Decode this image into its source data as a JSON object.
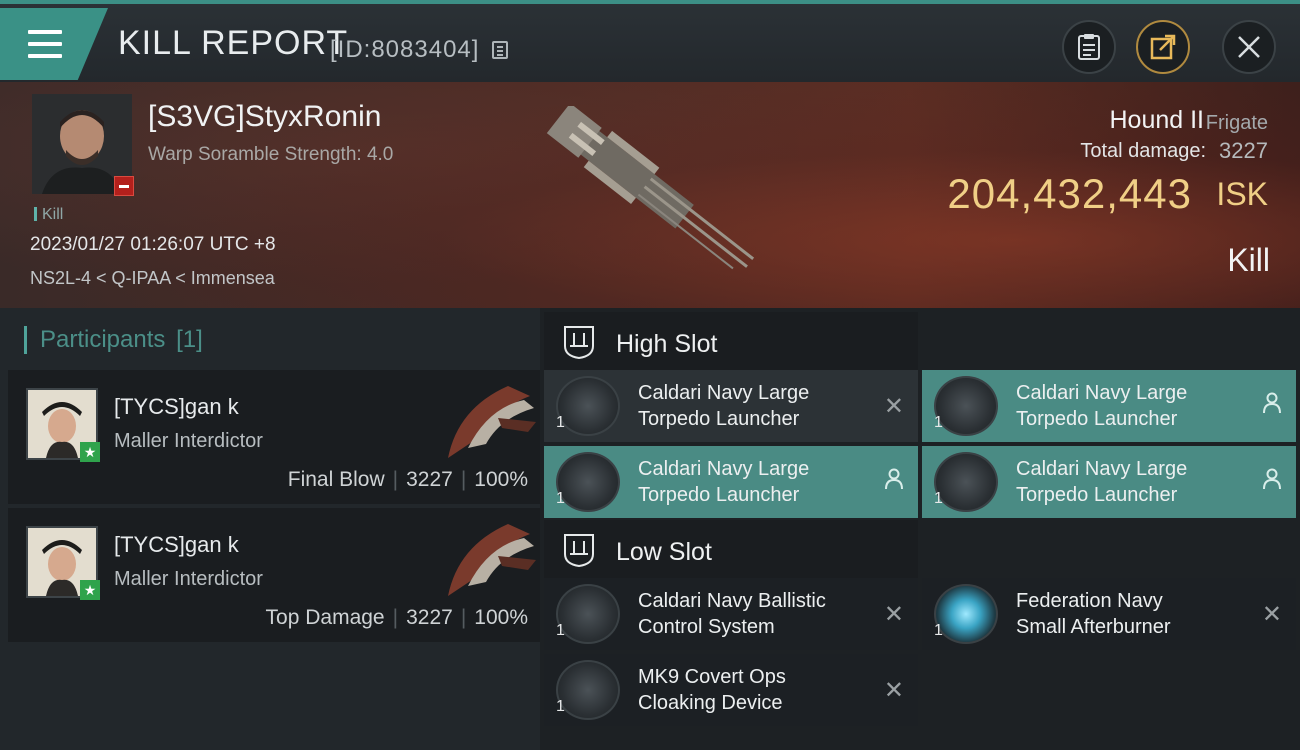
{
  "header": {
    "title": "KILL REPORT",
    "report_id": "[ID:8083404]",
    "accent_color": "#3a9186"
  },
  "victim": {
    "name": "[S3VG]StyxRonin",
    "scramble": "Warp Soramble Strength: 4.0",
    "tag": "Kill",
    "time": "2023/01/27 01:26:07 UTC +8",
    "location": "NS2L-4 < Q-IPAA < Immensea",
    "ship_name": "Hound II",
    "ship_class": "Frigate",
    "damage_label": "Total damage:",
    "damage_value": "3227",
    "isk_value": "204,432,443",
    "isk_unit": "ISK",
    "result": "Kill"
  },
  "participants": {
    "title": "Participants",
    "count": "[1]",
    "cards": [
      {
        "name": "[TYCS]gan k",
        "ship": "Maller Interdictor",
        "role": "Final Blow",
        "damage": "3227",
        "percent": "100%"
      },
      {
        "name": "[TYCS]gan k",
        "ship": "Maller Interdictor",
        "role": "Top Damage",
        "damage": "3227",
        "percent": "100%"
      }
    ]
  },
  "slots": {
    "high": {
      "title": "High Slot",
      "items": [
        {
          "line1": "Caldari Navy Large",
          "line2": "Torpedo Launcher",
          "qty": "1",
          "status": "destroyed-icon"
        },
        {
          "line1": "Caldari Navy Large",
          "line2": "Torpedo Launcher",
          "qty": "1",
          "status": "dropped-icon"
        },
        {
          "line1": "Caldari Navy Large",
          "line2": "Torpedo Launcher",
          "qty": "1",
          "status": "dropped-icon"
        },
        {
          "line1": "Caldari Navy Large",
          "line2": "Torpedo Launcher",
          "qty": "1",
          "status": "dropped-icon"
        }
      ]
    },
    "low": {
      "title": "Low Slot",
      "items": [
        {
          "line1": "Caldari Navy Ballistic",
          "line2": "Control System",
          "qty": "1",
          "status": "destroyed-icon"
        },
        {
          "line1": "Federation Navy",
          "line2": "Small Afterburner",
          "qty": "1",
          "status": "destroyed-icon"
        },
        {
          "line1": "MK9 Covert Ops",
          "line2": "Cloaking Device",
          "qty": "1",
          "status": "destroyed-icon"
        }
      ]
    }
  }
}
